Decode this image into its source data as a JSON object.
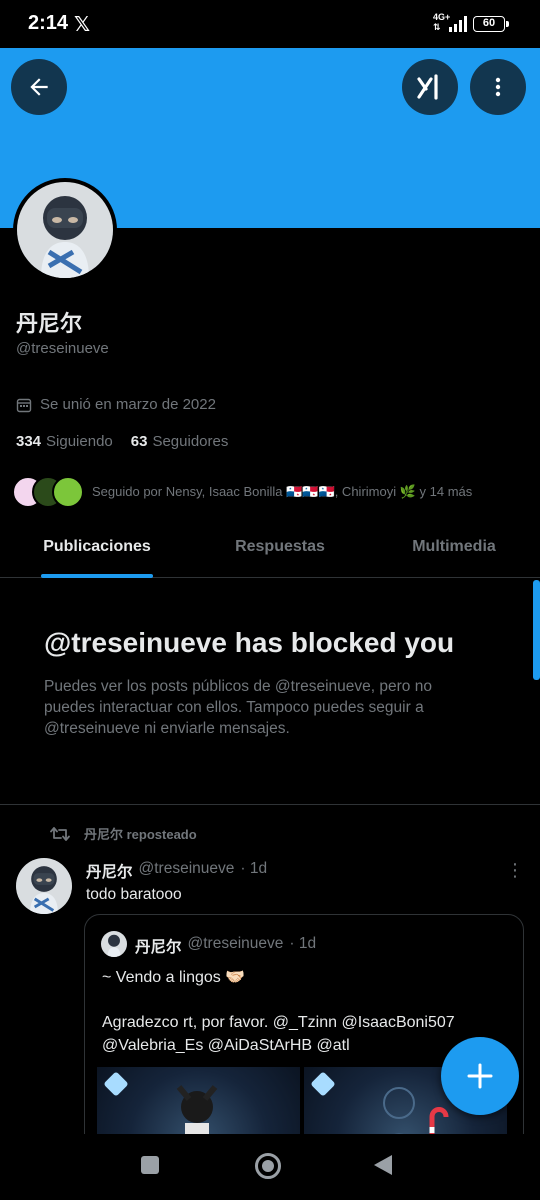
{
  "status_bar": {
    "time": "2:14",
    "app_glyph": "𝕏",
    "network_top": "4G+",
    "network_bottom": "⇅",
    "battery": "60"
  },
  "header": {
    "back_icon": "back-arrow-icon",
    "grok_icon": "grok-icon",
    "more_icon": "more-vertical-icon",
    "banner_color": "#1d9bf0"
  },
  "profile": {
    "display_name": "丹尼尔",
    "handle": "@treseinueve",
    "joined": "Se unió en marzo de 2022",
    "following_count": "334",
    "following_label": "Siguiendo",
    "followers_count": "63",
    "followers_label": "Seguidores",
    "followed_by": "Seguido por Nensy, Isaac Bonilla 🇵🇦🇵🇦🇵🇦, Chirimoyi 🌿 y 14 más"
  },
  "tabs": [
    {
      "label": "Publicaciones",
      "active": true
    },
    {
      "label": "Respuestas",
      "active": false
    },
    {
      "label": "Multimedia",
      "active": false
    }
  ],
  "blocked": {
    "title": "@treseinueve has blocked you",
    "description": "Puedes ver los posts públicos de @treseinueve, pero no puedes interactuar con ellos. Tampoco puedes seguir a @treseinueve ni enviarle mensajes."
  },
  "timeline": {
    "repost_label": "丹尼尔 reposteado",
    "post": {
      "name": "丹尼尔",
      "handle": "@treseinueve",
      "time": "· 1d",
      "text": "todo baratooo",
      "quote": {
        "name": "丹尼尔",
        "handle": "@treseinueve",
        "time": "· 1d",
        "line1": "~ Vendo a lingos 🤝🏻",
        "line2": "Agradezco rt, por favor. @_Tzinn @IsaacBoni507 @Valebria_Es @AiDaStArHB @atl"
      }
    }
  },
  "fab": {
    "icon": "plus-icon",
    "accent": "#1d9bf0"
  },
  "nav": {
    "recent_icon": "recents-square-icon",
    "home_icon": "home-circle-icon",
    "back_icon": "back-triangle-icon"
  }
}
